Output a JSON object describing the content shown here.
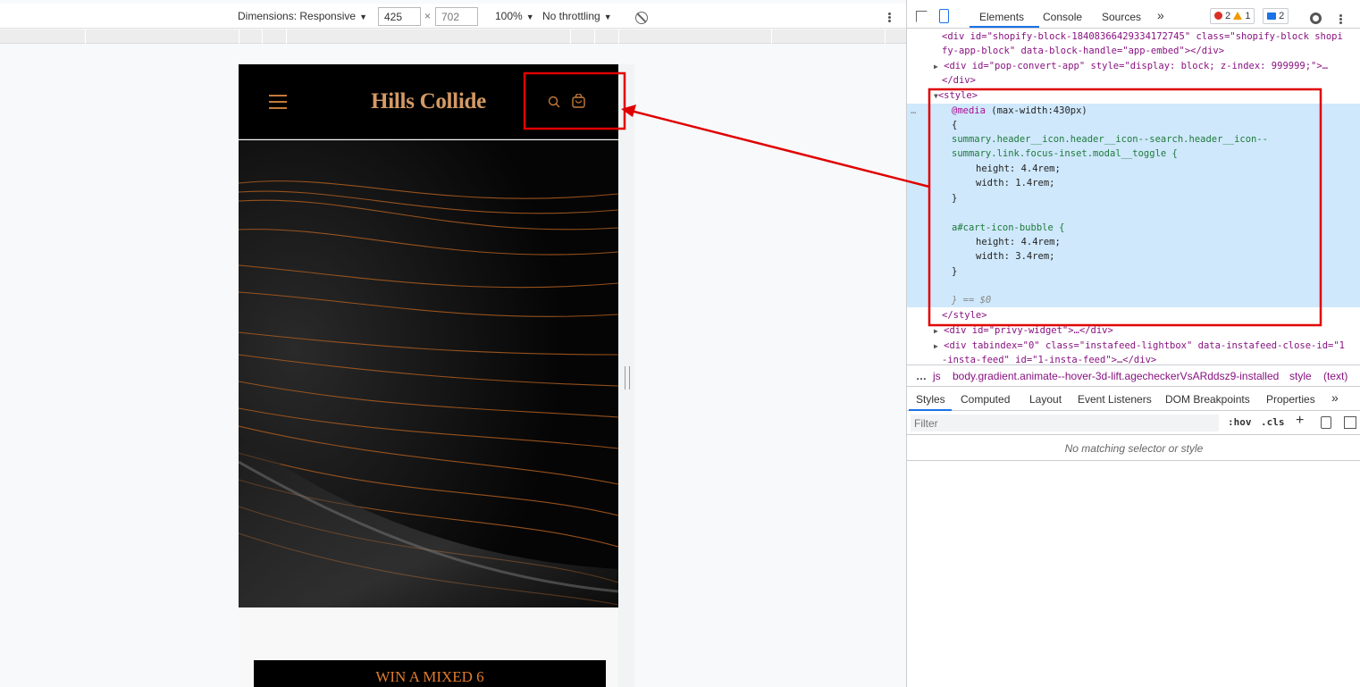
{
  "emulation": {
    "dimensions_label": "Dimensions: Responsive",
    "width_value": "425",
    "times": "×",
    "height_value": "702",
    "zoom": "100%",
    "throttling": "No throttling",
    "caret": "▼"
  },
  "site": {
    "logo": "Hills Collide",
    "promo": "WIN A MIXED 6",
    "accent": "#c57a3a"
  },
  "devtools": {
    "tabs": [
      "Elements",
      "Console",
      "Sources"
    ],
    "more_tabs": "»",
    "errors": "2",
    "warnings": "1",
    "messages": "2",
    "dom": {
      "l1a": "<div id=\"shopify-block-18408366429334172745\" class=\"shopify-block shopi",
      "l1b": "fy-app-block\" data-block-handle=\"app-embed\"></div>",
      "l2": "<div id=\"pop-convert-app\" style=\"display: block; z-index: 999999;\">…",
      "l3": "</div>",
      "l4": "<style>",
      "l5_kw": "@media",
      "l5_rest": " (max-width:430px)",
      "l6": "{",
      "l7": "summary.header__icon.header__icon--search.header__icon--",
      "l8": "summary.link.focus-inset.modal__toggle {",
      "l9": "height: 4.4rem;",
      "l10": "width: 1.4rem;",
      "l11": "}",
      "l12": "a#cart-icon-bubble {",
      "l13": "height: 4.4rem;",
      "l14": "width: 3.4rem;",
      "l15": "}",
      "l16": "} == $0",
      "l17": "</style>",
      "l18": "<div id=\"privy-widget\">…</div>",
      "l19a": "<div tabindex=\"0\" class=\"instafeed-lightbox\" data-instafeed-close-id=\"1",
      "l19b": "-insta-feed\" id=\"1-insta-feed\">…</div>",
      "gutter": "…"
    },
    "breadcrumb": {
      "dots": "…",
      "js": "js",
      "body": "body.gradient.animate--hover-3d-lift.agecheckerVsARddsz9-installed",
      "style": "style",
      "text": "(text)"
    },
    "subtabs": [
      "Styles",
      "Computed",
      "Layout",
      "Event Listeners",
      "DOM Breakpoints",
      "Properties"
    ],
    "filter_placeholder": "Filter",
    "hov": ":hov",
    "cls": ".cls",
    "plus": "+",
    "no_match": "No matching selector or style"
  }
}
